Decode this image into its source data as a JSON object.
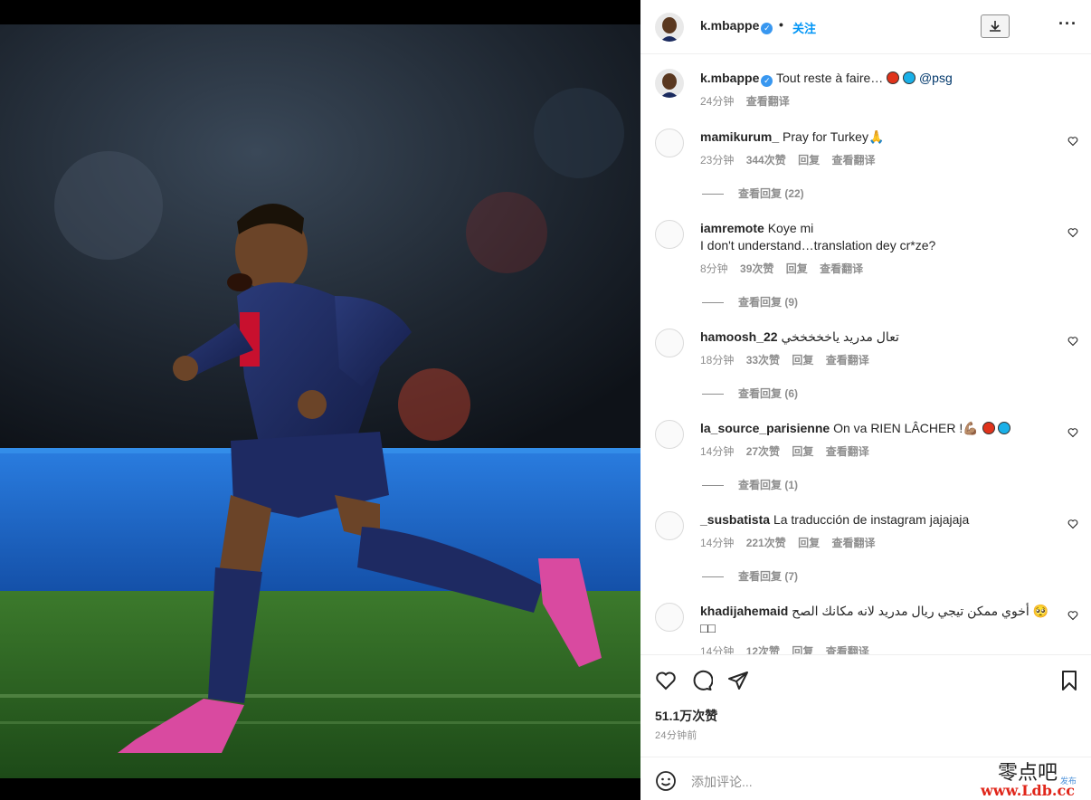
{
  "header": {
    "username": "k.mbappe",
    "separator": "•",
    "follow_label": "关注",
    "download_icon": "download-icon",
    "more_icon": "more-icon"
  },
  "caption": {
    "username": "k.mbappe",
    "text": "Tout reste à faire…",
    "mention": "@psg",
    "time": "24分钟",
    "translate": "查看翻译",
    "emoji_colors": [
      "#e0331b",
      "#1ab0e8"
    ]
  },
  "comments": [
    {
      "username": "mamikurum_",
      "text": "Pray for Turkey🙏",
      "time": "23分钟",
      "likes": "344次赞",
      "reply": "回复",
      "translate": "查看翻译",
      "view_replies": "查看回复 (22)"
    },
    {
      "username": "iamremote",
      "text": "Koye mi",
      "text2": "I don't understand…translation dey cr*ze?",
      "time": "8分钟",
      "likes": "39次赞",
      "reply": "回复",
      "translate": "查看翻译",
      "view_replies": "查看回复 (9)"
    },
    {
      "username": "hamoosh_22",
      "text": "تعال مدريد ياخخخخخي",
      "time": "18分钟",
      "likes": "33次赞",
      "reply": "回复",
      "translate": "查看翻译",
      "view_replies": "查看回复 (6)"
    },
    {
      "username": "la_source_parisienne",
      "text": "On va RIEN LÂCHER !💪🏽",
      "time": "14分钟",
      "likes": "27次赞",
      "reply": "回复",
      "translate": "查看翻译",
      "view_replies": "查看回复 (1)"
    },
    {
      "username": "_susbatista",
      "text": "La traducción de instagram jajajaja",
      "time": "14分钟",
      "likes": "221次赞",
      "reply": "回复",
      "translate": "查看翻译",
      "view_replies": "查看回复 (7)"
    },
    {
      "username": "khadijahemaid",
      "text": "أخوي ممكن تيجي ريال مدريد لانه مكانك الصح 🥺",
      "text2": "□□",
      "time": "14分钟",
      "likes": "12次赞",
      "reply": "回复",
      "translate": "查看翻译"
    }
  ],
  "footer": {
    "likes": "51.1万次赞",
    "time_ago": "24分钟前",
    "comment_placeholder": "添加评论..."
  },
  "watermark": {
    "cn": "零点吧",
    "url": "www.Ldb.cc",
    "small": "发布"
  },
  "colors": {
    "accent": "#0095f6",
    "verified": "#3897f0",
    "jersey": "#1a2a5e",
    "pitch": "#2d6a24",
    "board": "#1e6bd6"
  }
}
